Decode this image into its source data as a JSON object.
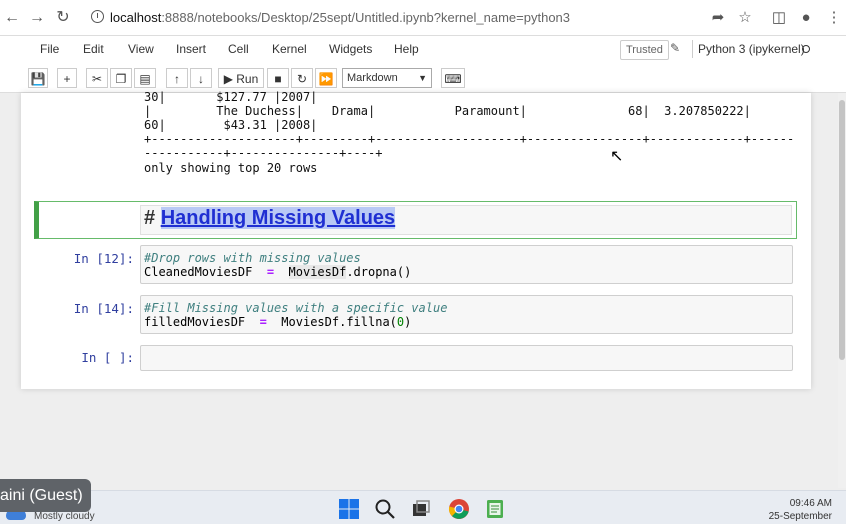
{
  "browser": {
    "url_host": "localhost",
    "url_path": ":8888/notebooks/Desktop/25sept/Untitled.ipynb?kernel_name=python3"
  },
  "menu": [
    "File",
    "Edit",
    "View",
    "Insert",
    "Cell",
    "Kernel",
    "Widgets",
    "Help"
  ],
  "status": {
    "trusted": "Trusted",
    "kernel": "Python 3 (ipykernel)"
  },
  "toolbar": {
    "run_label": "Run",
    "cell_type": "Markdown"
  },
  "output": {
    "lines": [
      "30|       $127.77 |2007|",
      "|         The Duchess|    Drama|           Paramount|              68|  3.207850222|",
      "60|        $43.31 |2008|",
      "+--------------------+---------+--------------------+----------------+-------------+------",
      "-----------+---------------+----+",
      "only showing top 20 rows"
    ]
  },
  "markdown_cell": {
    "hash": "# ",
    "heading": "Handling Missing Values"
  },
  "cells": [
    {
      "prompt": "In [12]:",
      "comment": "#Drop rows with missing values",
      "var": "CleanedMoviesDF",
      "eq": "=",
      "obj": "MoviesDf",
      "call": ".dropna()"
    },
    {
      "prompt": "In [14]:",
      "comment": "#Fill Missing values with a specific value",
      "var": "filledMoviesDF",
      "eq": "=",
      "obj": "MoviesDf",
      "call": ".fillna(",
      "arg": "0",
      "close": ")"
    },
    {
      "prompt": "In [ ]:"
    }
  ],
  "taskbar": {
    "user": "aini (Guest)",
    "weather": "Mostly cloudy",
    "time": "09:46 AM",
    "date": "25-September"
  }
}
